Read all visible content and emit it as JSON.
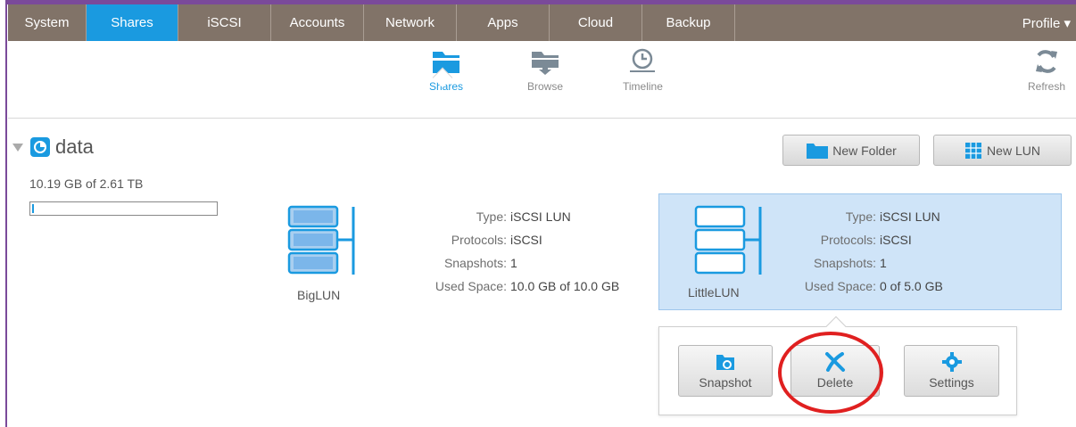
{
  "nav": {
    "tabs": [
      "System",
      "Shares",
      "iSCSI",
      "Accounts",
      "Network",
      "Apps",
      "Cloud",
      "Backup"
    ],
    "active_tab": "Shares",
    "profile": "Profile ▾"
  },
  "subbar": {
    "shares": "Shares",
    "browse": "Browse",
    "timeline": "Timeline",
    "refresh": "Refresh"
  },
  "volume": {
    "title": "data",
    "usage": "10.19 GB of 2.61 TB",
    "usage_fraction": 0.004,
    "new_folder": "New Folder",
    "new_lun": "New LUN"
  },
  "luns": [
    {
      "name": "BigLUN",
      "type_label": "Type:",
      "type": "iSCSI LUN",
      "protocols_label": "Protocols:",
      "protocols": "iSCSI",
      "snapshots_label": "Snapshots:",
      "snapshots": "1",
      "used_label": "Used Space:",
      "used": "10.0 GB of 10.0 GB"
    },
    {
      "name": "LittleLUN",
      "type_label": "Type:",
      "type": "iSCSI LUN",
      "protocols_label": "Protocols:",
      "protocols": "iSCSI",
      "snapshots_label": "Snapshots:",
      "snapshots": "1",
      "used_label": "Used Space:",
      "used": "0 of 5.0 GB"
    }
  ],
  "actions": {
    "snapshot": "Snapshot",
    "delete": "Delete",
    "settings": "Settings"
  },
  "colors": {
    "accent": "#1a9ae0",
    "nav_bg": "#817368",
    "highlight": "#e02020"
  }
}
